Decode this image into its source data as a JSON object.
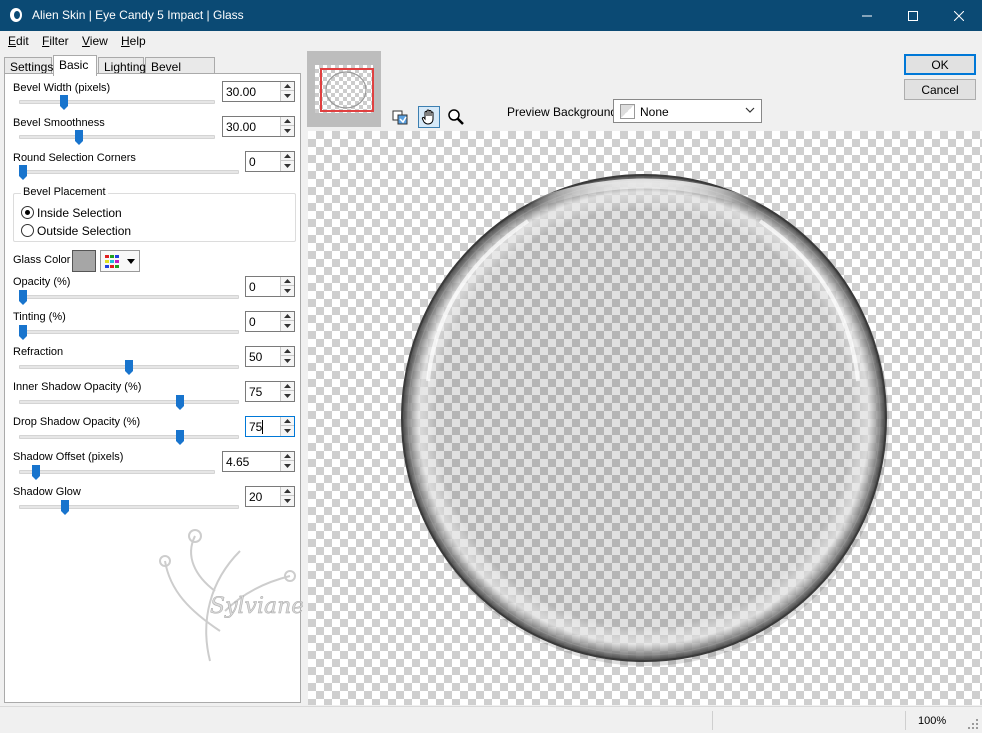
{
  "window": {
    "title": "Alien Skin | Eye Candy 5 Impact | Glass",
    "title_color": "#0b4a74"
  },
  "menu": [
    "Edit",
    "Filter",
    "View",
    "Help"
  ],
  "tabs": [
    {
      "label": "Settings",
      "active": false
    },
    {
      "label": "Basic",
      "active": true
    },
    {
      "label": "Lighting",
      "active": false
    },
    {
      "label": "Bevel Profile",
      "active": false
    }
  ],
  "basic": {
    "bevel_width": {
      "label": "Bevel Width (pixels)",
      "value": "30.00",
      "slider_fraction": 0.22
    },
    "bevel_smoothness": {
      "label": "Bevel Smoothness",
      "value": "30.00",
      "slider_fraction": 0.3
    },
    "round_corners": {
      "label": "Round Selection Corners",
      "value": "0",
      "slider_fraction": 0.0
    },
    "bevel_placement": {
      "legend": "Bevel Placement",
      "inside": "Inside Selection",
      "outside": "Outside Selection",
      "selected": "inside"
    },
    "glass_color": {
      "label": "Glass Color",
      "swatch": "#a6a6a6"
    },
    "opacity": {
      "label": "Opacity (%)",
      "value": "0",
      "slider_fraction": 0.0
    },
    "tinting": {
      "label": "Tinting (%)",
      "value": "0",
      "slider_fraction": 0.0
    },
    "refraction": {
      "label": "Refraction",
      "value": "50",
      "slider_fraction": 0.5
    },
    "inner_shadow": {
      "label": "Inner Shadow Opacity (%)",
      "value": "75",
      "slider_fraction": 0.74
    },
    "drop_shadow": {
      "label": "Drop Shadow Opacity (%)",
      "value": "75",
      "slider_fraction": 0.74
    },
    "shadow_offset": {
      "label": "Shadow Offset (pixels)",
      "value": "4.65",
      "slider_fraction": 0.07
    },
    "shadow_glow": {
      "label": "Shadow Glow",
      "value": "20",
      "slider_fraction": 0.2
    }
  },
  "watermark": {
    "text": "Sylviane"
  },
  "preview": {
    "background_label": "Preview Background:",
    "background_value": "None"
  },
  "buttons": {
    "ok": "OK",
    "cancel": "Cancel"
  },
  "status": {
    "zoom": "100%"
  },
  "colors": {
    "accent": "#0078d7",
    "slider_thumb": "#1874cd"
  }
}
